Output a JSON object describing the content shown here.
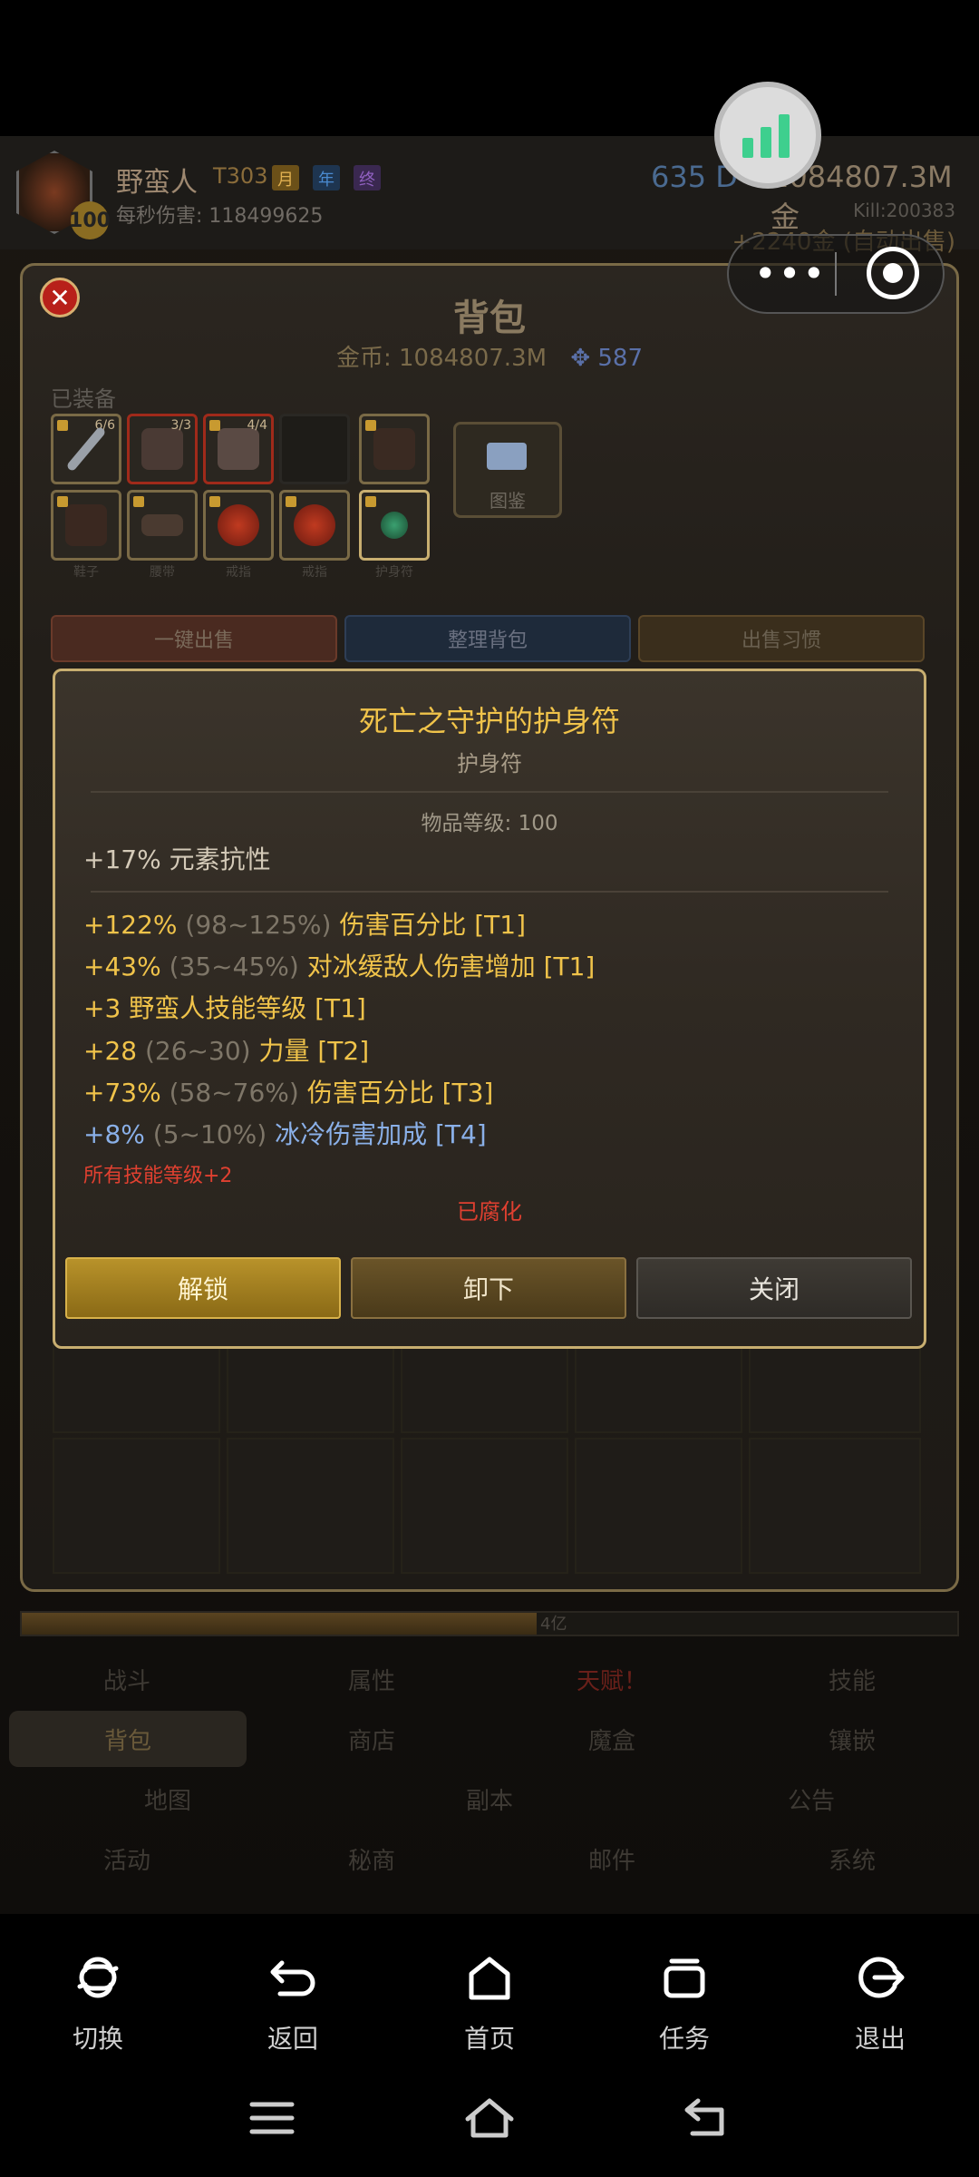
{
  "hero": {
    "name": "野蛮人",
    "tier": "T303",
    "badges": [
      "月",
      "年",
      "终"
    ],
    "level": "100",
    "dps": "每秒伤害: 118499625",
    "res_top": "635 D",
    "res_gold": "1084807.3M 金",
    "kill_count": "Kill:200383",
    "auto_gold": "+2240金 (自动出售)"
  },
  "backpack": {
    "title": "背包",
    "gold": "金币: 1084807.3M",
    "gems": "587",
    "equipped_label": "已装备",
    "slots_row1": [
      {
        "count": "6/6",
        "color": "#9aa0a8"
      },
      {
        "count": "3/3",
        "color": "#4a3a34"
      },
      {
        "count": "4/4",
        "color": "#5a4a44"
      },
      {
        "count": "",
        "color": "#2a2824"
      },
      {
        "count": "",
        "color": "#3a2a22"
      }
    ],
    "slots_row2": [
      {
        "name": "鞋子",
        "color": "#3a2820"
      },
      {
        "name": "腰带",
        "color": "#4a3a30"
      },
      {
        "name": "戒指",
        "color": "#8a2a1a"
      },
      {
        "name": "戒指",
        "color": "#8a2a1a"
      },
      {
        "name": "护身符",
        "color": "#2a6a4a"
      }
    ],
    "codex_label": "图鉴",
    "actions": {
      "sell_all": "一键出售",
      "sort": "整理背包",
      "sell_habit": "出售习惯"
    }
  },
  "tooltip": {
    "item_name": "死亡之守护的护身符",
    "item_type": "护身符",
    "item_level": "物品等级: 100",
    "implicit": "+17% 元素抗性",
    "affixes": [
      {
        "value": "+122%",
        "range": "(98~125%)",
        "name": "伤害百分比 [T1]",
        "blue": false
      },
      {
        "value": "+43%",
        "range": "(35~45%)",
        "name": "对冰缓敌人伤害增加 [T1]",
        "blue": false
      },
      {
        "value": "+3",
        "range": "",
        "name": "野蛮人技能等级 [T1]",
        "blue": false
      },
      {
        "value": "+28",
        "range": "(26~30)",
        "name": "力量 [T2]",
        "blue": false
      },
      {
        "value": "+73%",
        "range": "(58~76%)",
        "name": "伤害百分比 [T3]",
        "blue": false
      },
      {
        "value": "+8%",
        "range": "(5~10%)",
        "name": "冰冷伤害加成 [T4]",
        "blue": true
      }
    ],
    "special_mod": "所有技能等级+2",
    "corrupted": "已腐化",
    "buttons": {
      "unlock": "解锁",
      "unequip": "卸下",
      "close": "关闭"
    }
  },
  "exp_bar": {
    "fill": 0.55,
    "text": "4亿"
  },
  "nav": {
    "row1": [
      "战斗",
      "属性",
      "天赋！",
      "技能"
    ],
    "row2": [
      "背包",
      "商店",
      "魔盒",
      "镶嵌"
    ],
    "row3": [
      "地图",
      "副本",
      "公告"
    ],
    "row4": [
      "活动",
      "秘商",
      "邮件",
      "系统"
    ]
  },
  "system_nav": [
    {
      "label": "切换",
      "icon": "switch-icon"
    },
    {
      "label": "返回",
      "icon": "back-icon"
    },
    {
      "label": "首页",
      "icon": "home-icon"
    },
    {
      "label": "任务",
      "icon": "tasks-icon"
    },
    {
      "label": "退出",
      "icon": "exit-icon"
    }
  ],
  "colors": {
    "gold_text": "#f0c34a",
    "blue_affix": "#8ab0e8",
    "corrupt_red": "#e04030",
    "tooltip_border": "#c8ae70"
  }
}
